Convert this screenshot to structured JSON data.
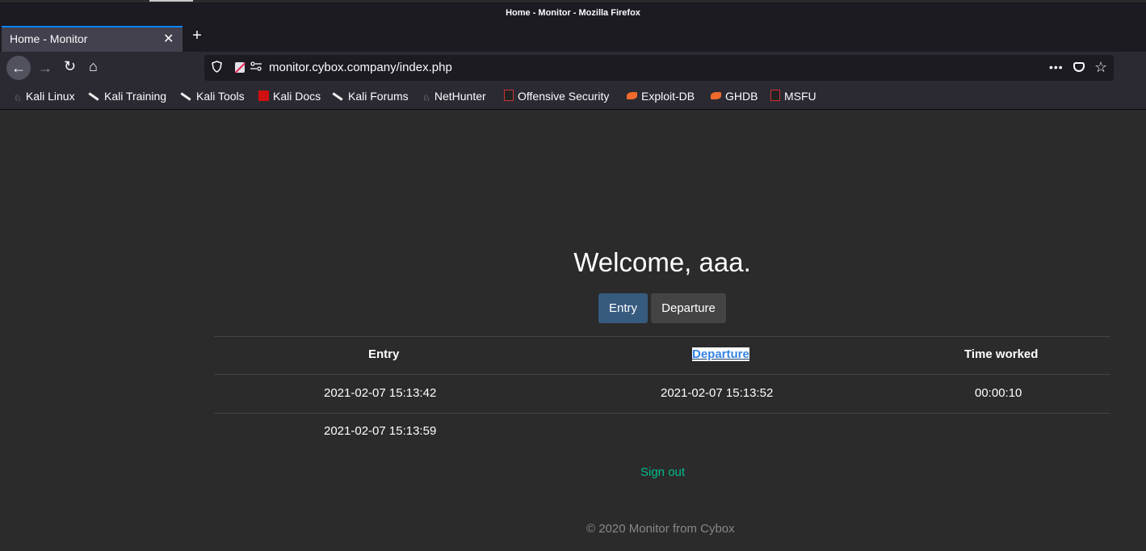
{
  "window": {
    "title": "Home - Monitor - Mozilla Firefox"
  },
  "tabs": [
    {
      "label": "Home - Monitor",
      "close": "✕"
    }
  ],
  "new_tab": "+",
  "nav": {
    "back": "←",
    "forward": "→",
    "reload": "↻",
    "home": "⌂"
  },
  "url": {
    "text": "monitor.cybox.company/index.php",
    "more": "•••",
    "star": "☆"
  },
  "bookmarks": [
    {
      "label": "Kali Linux",
      "icon": "kali-icon"
    },
    {
      "label": "Kali Training",
      "icon": "kali-dragon-icon"
    },
    {
      "label": "Kali Tools",
      "icon": "kali-dragon-icon"
    },
    {
      "label": "Kali Docs",
      "icon": "kali-docs-icon"
    },
    {
      "label": "Kali Forums",
      "icon": "kali-dragon-icon"
    },
    {
      "label": "NetHunter",
      "icon": "kali-icon"
    },
    {
      "label": "Offensive Security",
      "icon": "offsec-icon"
    },
    {
      "label": "Exploit-DB",
      "icon": "exploitdb-icon"
    },
    {
      "label": "GHDB",
      "icon": "exploitdb-icon"
    },
    {
      "label": "MSFU",
      "icon": "offsec-icon"
    }
  ],
  "page": {
    "welcome": "Welcome, aaa.",
    "buttons": {
      "entry": "Entry",
      "departure": "Departure"
    },
    "table": {
      "headers": [
        "Entry",
        "Departure",
        "Time worked"
      ],
      "rows": [
        [
          "2021-02-07 15:13:42",
          "2021-02-07 15:13:52",
          "00:00:10"
        ],
        [
          "2021-02-07 15:13:59",
          "",
          ""
        ]
      ]
    },
    "signout": "Sign out",
    "footer": "© 2020 Monitor from Cybox"
  },
  "colors": {
    "accent_tab": "#0a84ff",
    "entry_button": "#375a7f",
    "departure_button": "#444444",
    "signout_link": "#00bc8c",
    "selection": "#3584e4"
  }
}
